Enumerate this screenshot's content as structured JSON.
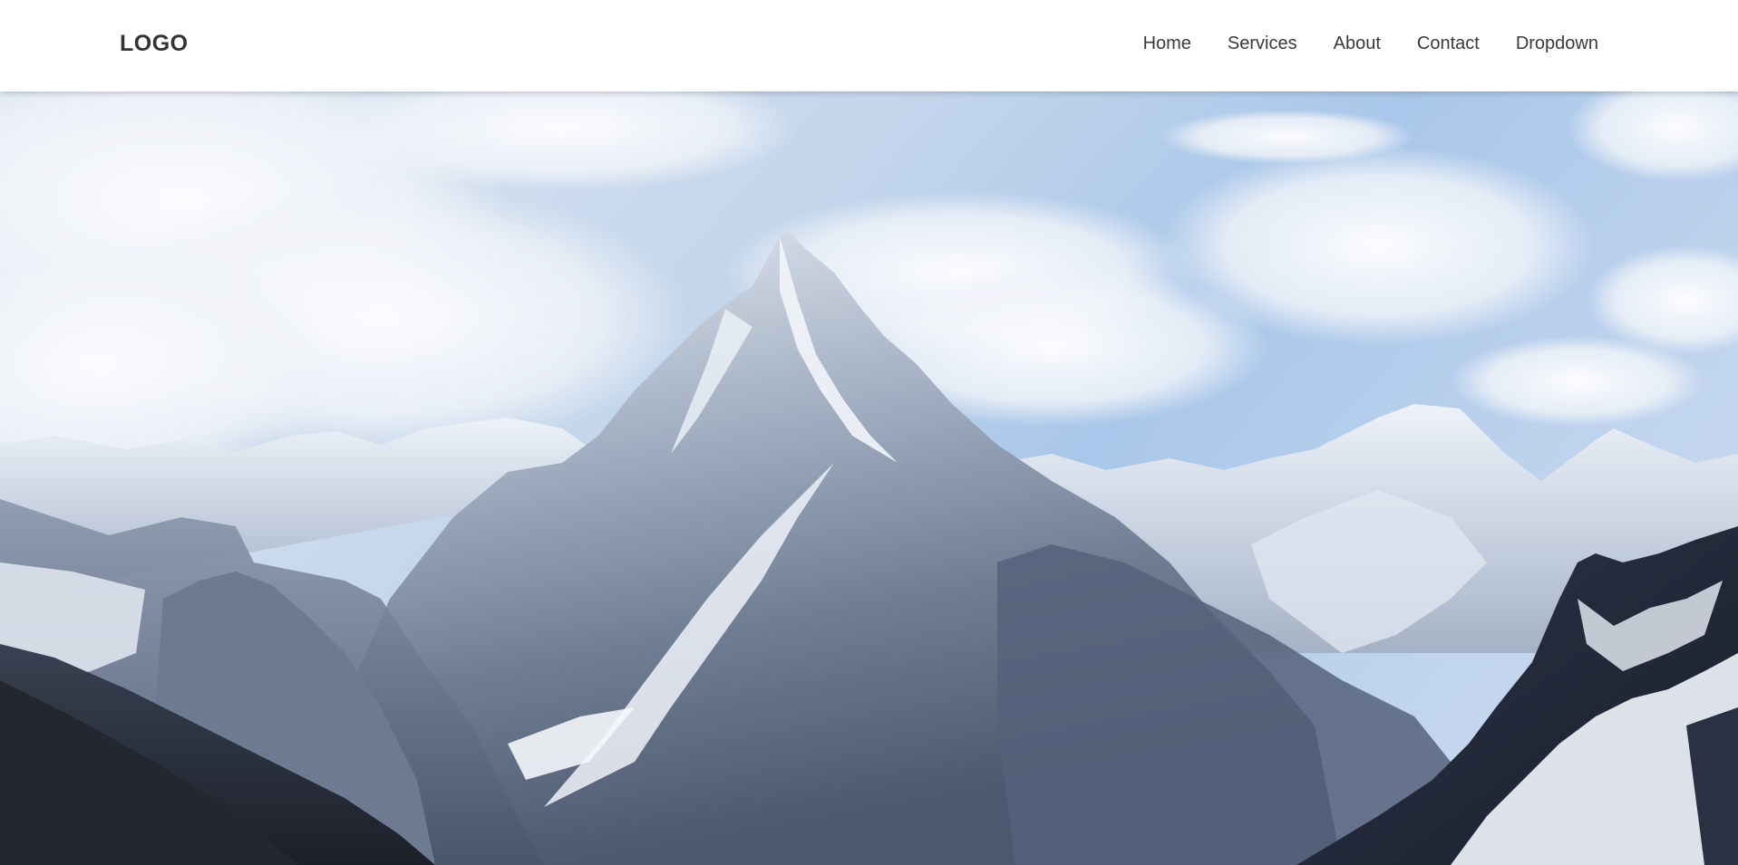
{
  "header": {
    "logo": "LOGO",
    "nav": [
      {
        "label": "Home"
      },
      {
        "label": "Services"
      },
      {
        "label": "About"
      },
      {
        "label": "Contact"
      },
      {
        "label": "Dropdown"
      }
    ]
  },
  "hero": {
    "image_subject": "snow-capped mountain range under cloudy blue sky",
    "colors": {
      "sky_top": "#c9d9ee",
      "sky_blue": "#a8c6ea",
      "cloud": "#f4f6fa",
      "snow": "#e6ecf4",
      "rock_mid": "#7f8ea5",
      "rock_dark": "#3b4457",
      "foreground_dark": "#1f232c"
    }
  }
}
